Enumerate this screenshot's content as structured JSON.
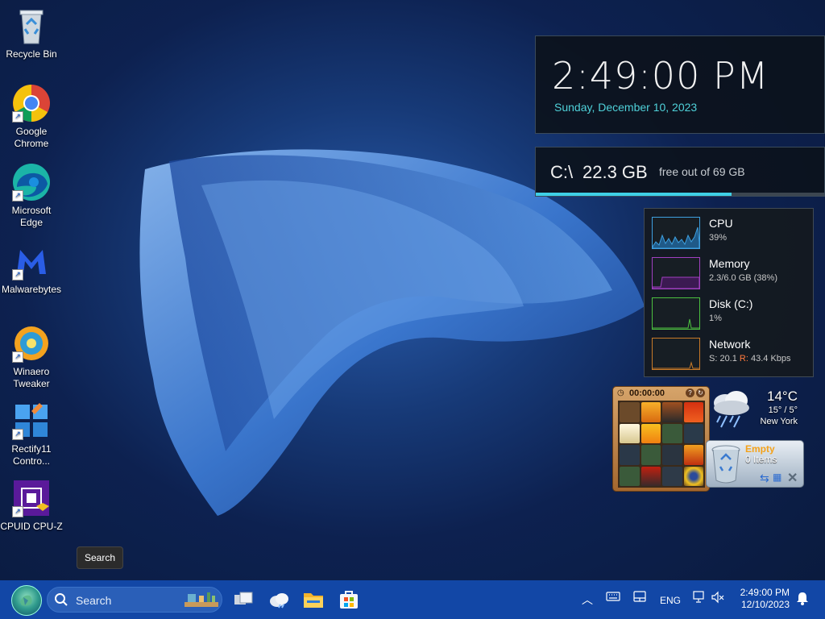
{
  "desktop": {
    "icons": [
      {
        "label": "Recycle Bin"
      },
      {
        "label": "Google\nChrome"
      },
      {
        "label": "Microsoft\nEdge"
      },
      {
        "label": "Malwarebytes"
      },
      {
        "label": "Winaero\nTweaker"
      },
      {
        "label": "Rectify11\nContro..."
      },
      {
        "label": "CPUID CPU-Z"
      }
    ]
  },
  "clock_widget": {
    "time": "2:49:00 PM",
    "date": "Sunday, December 10, 2023",
    "date_color": "#4fd1d9"
  },
  "drive_widget": {
    "path": "C:\\",
    "free": "22.3 GB",
    "desc": "free out of 69 GB",
    "used_fraction": 0.68
  },
  "perf_monitor": {
    "items": [
      {
        "name": "CPU",
        "value": "39%",
        "color": "#3ea0e0"
      },
      {
        "name": "Memory",
        "value": "2.3/6.0 GB (38%)",
        "color": "#a040c0"
      },
      {
        "name": "Disk (C:)",
        "value": "1%",
        "color": "#4cc040"
      },
      {
        "name": "Network",
        "value_s": "S: 20.1",
        "value_r": "R:",
        "value_r2": "43.4 Kbps",
        "color": "#c87a28"
      }
    ]
  },
  "weather": {
    "temp": "14°C",
    "range": "15° / 5°",
    "city": "New York",
    "icon": "rain-cloud-icon"
  },
  "puzzle": {
    "timer": "00:00:00"
  },
  "recycle_gadget": {
    "status": "Empty",
    "count": "0 Items"
  },
  "tooltip": {
    "text": "Search"
  },
  "taskbar": {
    "search_placeholder": "Search",
    "language": "ENG",
    "time": "2:49:00 PM",
    "date": "12/10/2023",
    "color": "#1247a6"
  }
}
